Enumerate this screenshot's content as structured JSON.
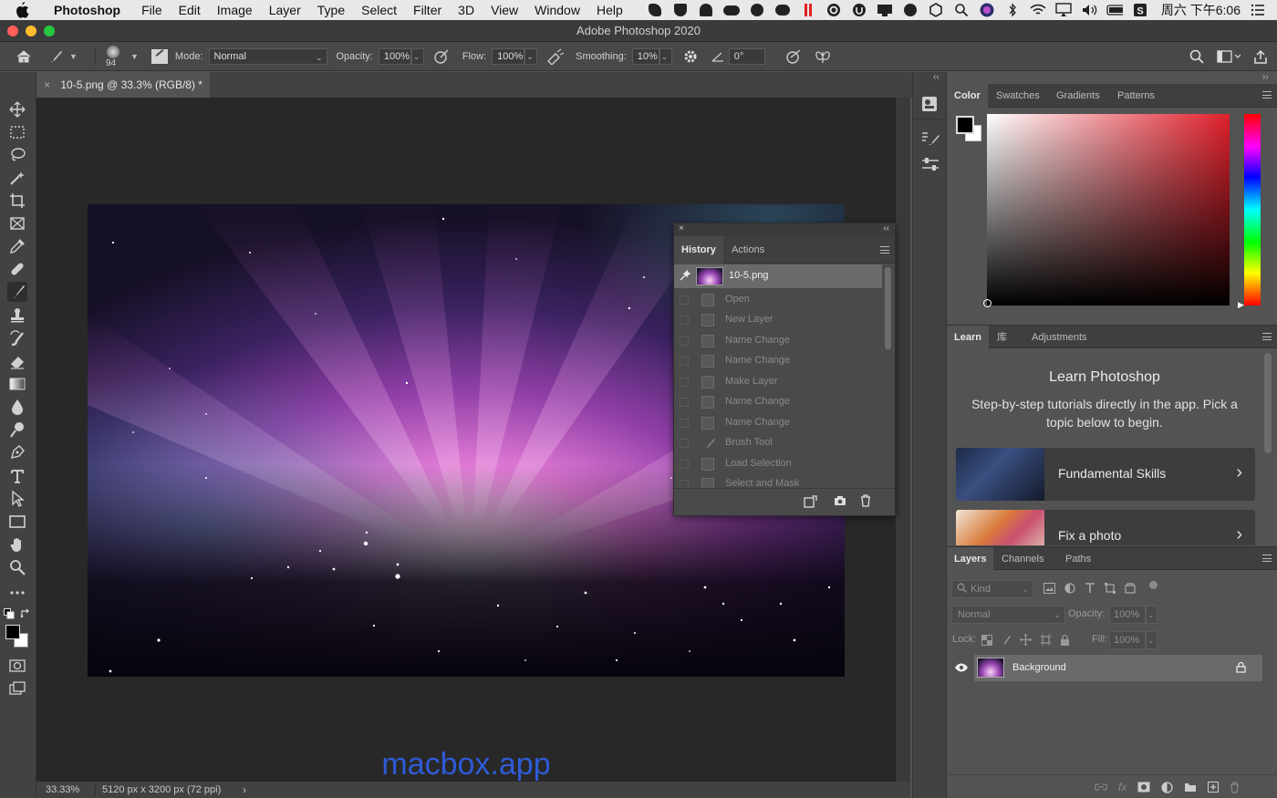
{
  "menubar": {
    "app_name": "Photoshop",
    "items": [
      "File",
      "Edit",
      "Image",
      "Layer",
      "Type",
      "Select",
      "Filter",
      "3D",
      "View",
      "Window",
      "Help"
    ],
    "clock": "周六 下午6:06"
  },
  "window": {
    "title": "Adobe Photoshop 2020"
  },
  "options_bar": {
    "brush_size": "94",
    "mode_label": "Mode:",
    "mode_value": "Normal",
    "opacity_label": "Opacity:",
    "opacity_value": "100%",
    "flow_label": "Flow:",
    "flow_value": "100%",
    "smoothing_label": "Smoothing:",
    "smoothing_value": "10%",
    "angle_value": "0°"
  },
  "document": {
    "tab_title": "10-5.png @ 33.3% (RGB/8) *",
    "zoom": "33.33%",
    "info": "5120 px x 3200 px (72 ppi)"
  },
  "watermark": "macbox.app",
  "history_panel": {
    "tabs": [
      "History",
      "Actions"
    ],
    "snapshot": "10-5.png",
    "states": [
      "Open",
      "New Layer",
      "Name Change",
      "Name Change",
      "Make Layer",
      "Name Change",
      "Name Change",
      "Brush Tool",
      "Load Selection",
      "Select and Mask"
    ]
  },
  "color_panel": {
    "tabs": [
      "Color",
      "Swatches",
      "Gradients",
      "Patterns"
    ],
    "foreground": "#000000",
    "background": "#ffffff",
    "hue_accent": "#e0202c"
  },
  "learn_panel": {
    "tabs": [
      "Learn",
      "库",
      "Adjustments"
    ],
    "title": "Learn Photoshop",
    "description": "Step-by-step tutorials directly in the app. Pick a topic below to begin.",
    "cards": [
      "Fundamental Skills",
      "Fix a photo"
    ]
  },
  "layers_panel": {
    "tabs": [
      "Layers",
      "Channels",
      "Paths"
    ],
    "kind_placeholder": "Kind",
    "blend_mode": "Normal",
    "opacity_label": "Opacity:",
    "opacity_value": "100%",
    "lock_label": "Lock:",
    "fill_label": "Fill:",
    "fill_value": "100%",
    "layers": [
      {
        "name": "Background",
        "visible": true,
        "locked": true
      }
    ]
  }
}
